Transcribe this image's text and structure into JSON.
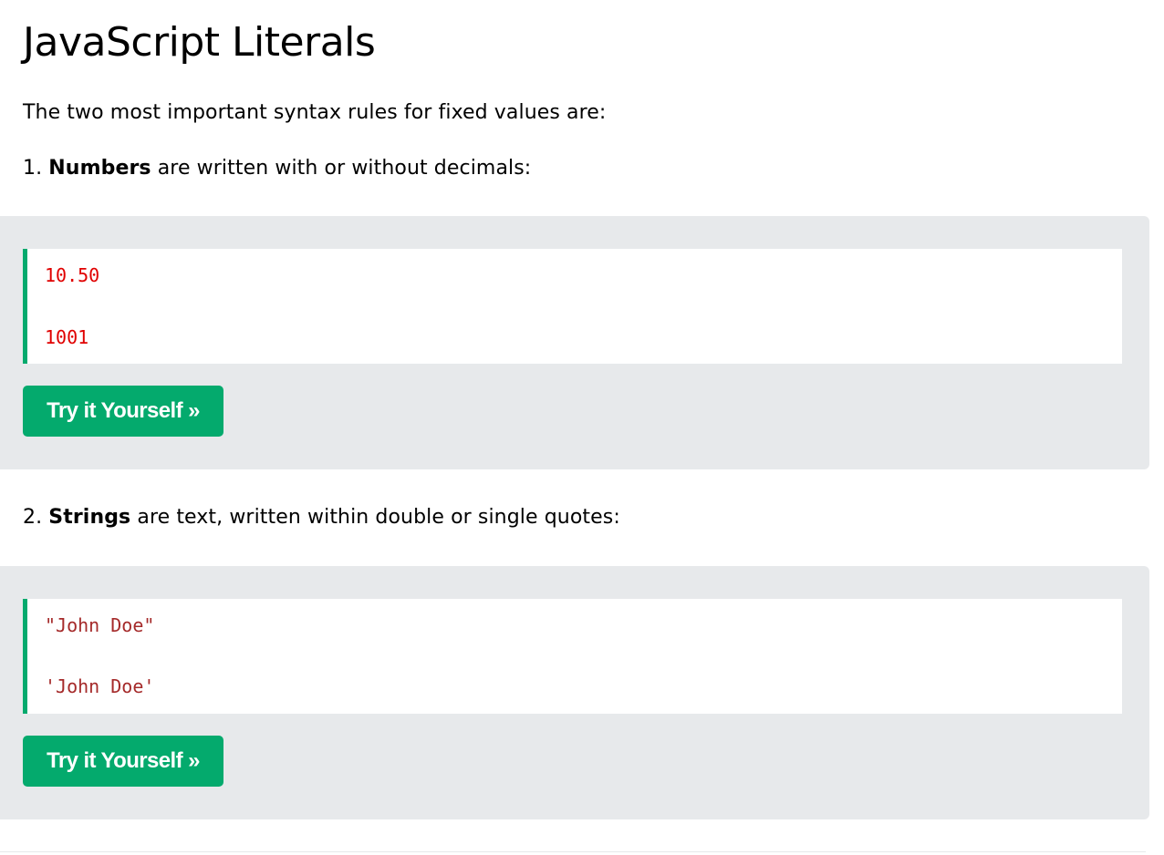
{
  "heading": "JavaScript Literals",
  "intro": "The two most important syntax rules for fixed values are:",
  "rules": [
    {
      "number": "1.",
      "keyword": "Numbers",
      "text": "are written with or without decimals:",
      "examples": [
        "10.50",
        "1001"
      ],
      "button_label": "Try it Yourself »"
    },
    {
      "number": "2.",
      "keyword": "Strings",
      "text": "are text, written within double or single quotes:",
      "examples": [
        "\"John Doe\"",
        "'John Doe'"
      ],
      "button_label": "Try it Yourself »"
    }
  ],
  "colors": {
    "accent": "#04aa6d",
    "panel_background": "#e7e9eb",
    "number_literal": "#e00000",
    "string_literal": "#a52a2a"
  }
}
